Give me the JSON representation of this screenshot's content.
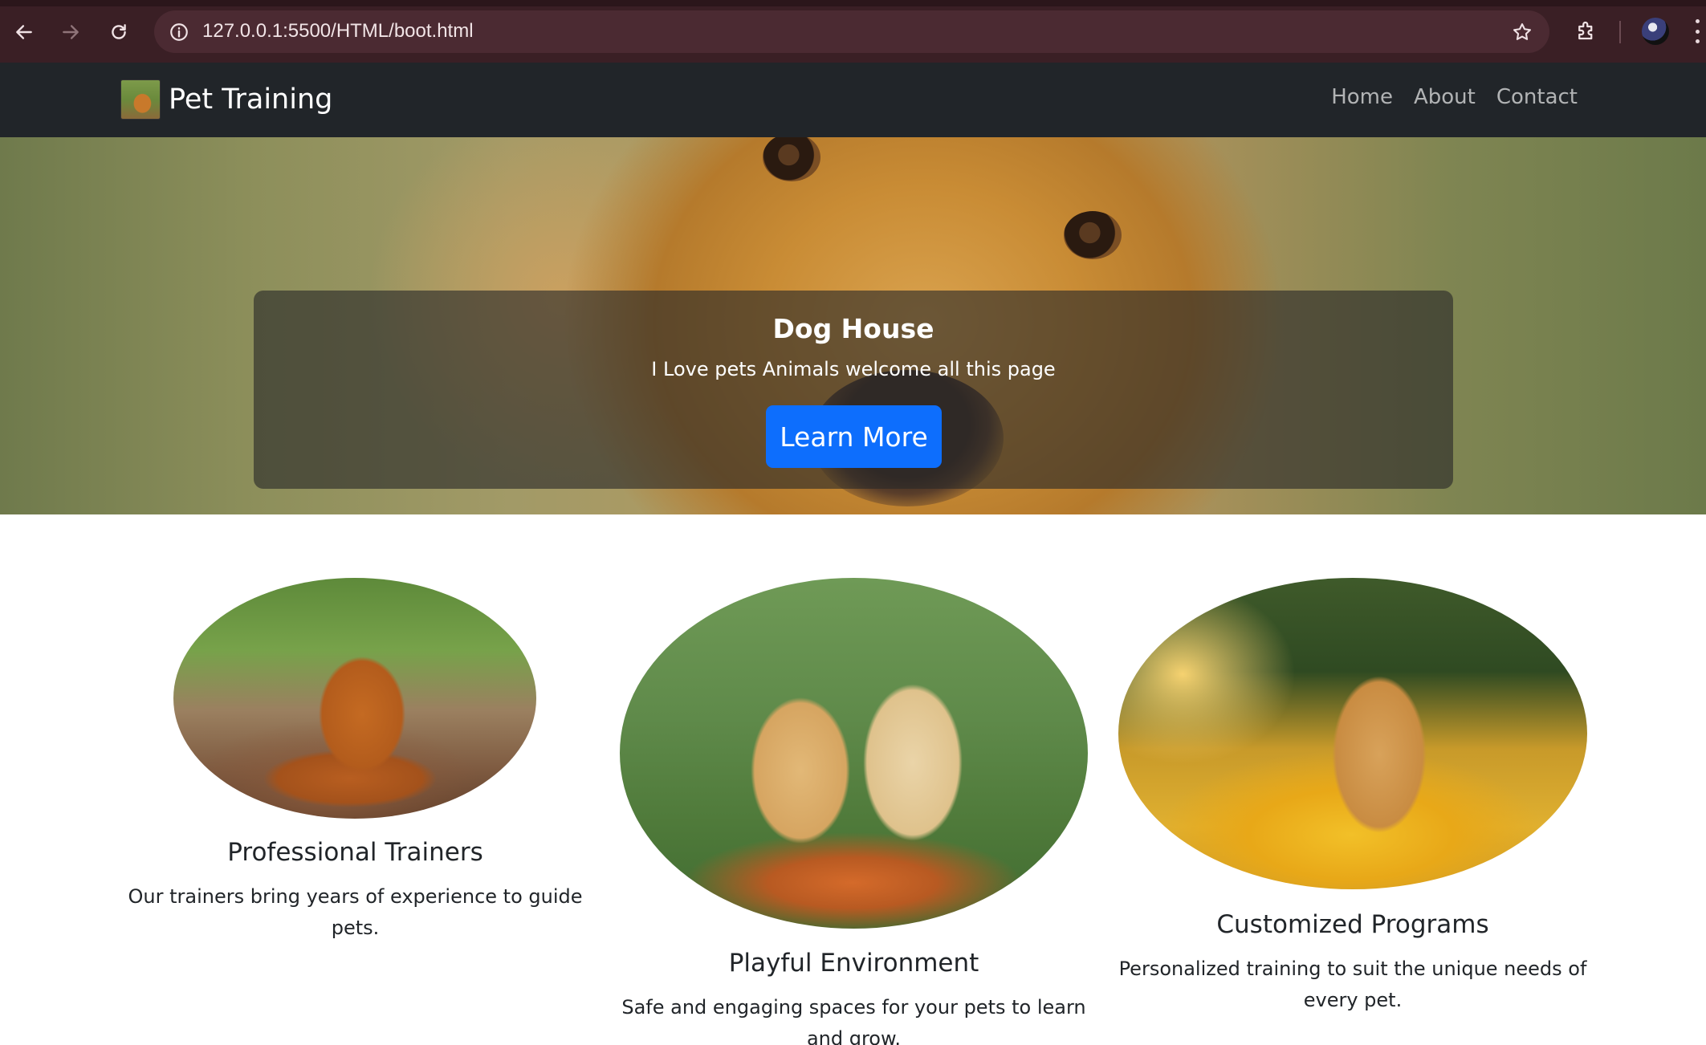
{
  "browser": {
    "url": "127.0.0.1:5500/HTML/boot.html",
    "icons": [
      "back-arrow-icon",
      "forward-arrow-icon",
      "reload-icon",
      "site-info-icon",
      "bookmark-star-icon",
      "extensions-icon",
      "profile-avatar",
      "more-menu-icon"
    ]
  },
  "navbar": {
    "brand": "Pet Training",
    "links": [
      {
        "label": "Home"
      },
      {
        "label": "About"
      },
      {
        "label": "Contact"
      }
    ]
  },
  "hero": {
    "title": "Dog House",
    "text": "I Love pets Animals welcome all this page",
    "button_label": "Learn More",
    "button_color": "#0d6efd"
  },
  "features": [
    {
      "title": "Professional Trainers",
      "text_line1": "Our trainers bring years of experience to guide",
      "text_line2": "pets."
    },
    {
      "title": "Playful Environment",
      "text_line1": "Safe and engaging spaces for your pets to learn",
      "text_line2": "and grow."
    },
    {
      "title": "Customized Programs",
      "text_line1": "Personalized training to suit the unique needs of",
      "text_line2": "every pet."
    }
  ],
  "colors": {
    "navbar_bg": "#212529",
    "browser_bg": "#3a1f25"
  }
}
